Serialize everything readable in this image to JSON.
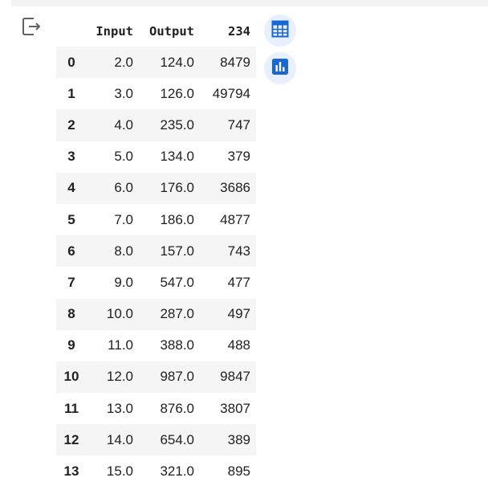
{
  "table": {
    "columns": [
      "",
      "Input",
      "Output",
      "234"
    ],
    "rows": [
      {
        "index": "0",
        "input": "2.0",
        "output": "124.0",
        "col234": "8479"
      },
      {
        "index": "1",
        "input": "3.0",
        "output": "126.0",
        "col234": "49794"
      },
      {
        "index": "2",
        "input": "4.0",
        "output": "235.0",
        "col234": "747"
      },
      {
        "index": "3",
        "input": "5.0",
        "output": "134.0",
        "col234": "379"
      },
      {
        "index": "4",
        "input": "6.0",
        "output": "176.0",
        "col234": "3686"
      },
      {
        "index": "5",
        "input": "7.0",
        "output": "186.0",
        "col234": "4877"
      },
      {
        "index": "6",
        "input": "8.0",
        "output": "157.0",
        "col234": "743"
      },
      {
        "index": "7",
        "input": "9.0",
        "output": "547.0",
        "col234": "477"
      },
      {
        "index": "8",
        "input": "10.0",
        "output": "287.0",
        "col234": "497"
      },
      {
        "index": "9",
        "input": "11.0",
        "output": "388.0",
        "col234": "488"
      },
      {
        "index": "10",
        "input": "12.0",
        "output": "987.0",
        "col234": "9847"
      },
      {
        "index": "11",
        "input": "13.0",
        "output": "876.0",
        "col234": "3807"
      },
      {
        "index": "12",
        "input": "14.0",
        "output": "654.0",
        "col234": "389"
      },
      {
        "index": "13",
        "input": "15.0",
        "output": "321.0",
        "col234": "895"
      }
    ]
  },
  "icons": {
    "output": "output-arrow-icon",
    "table_button": "table-grid-icon",
    "chart_button": "bar-chart-icon"
  },
  "colors": {
    "accent": "#1967d2",
    "fab_background": "#e8f0fe",
    "stripe": "#f5f5f5",
    "output_icon": "#616161"
  }
}
